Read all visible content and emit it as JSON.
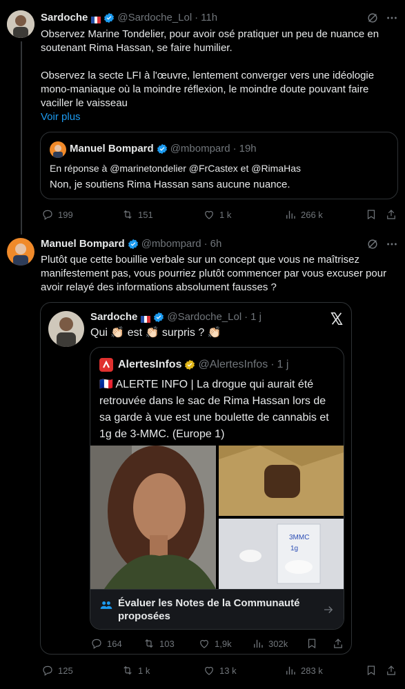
{
  "tweet1": {
    "name": "Sardoche",
    "handle": "@Sardoche_Lol",
    "sep": "·",
    "time": "11h",
    "para1": "Observez Marine Tondelier, pour avoir osé pratiquer un peu de nuance en soutenant Rima Hassan, se faire humilier.",
    "para2": "Observez la secte LFI à l'œuvre, lentement converger vers une idéologie mono-maniaque où la moindre réflexion, le moindre doute pouvant faire vaciller le vaisseau",
    "show_more": "Voir plus",
    "quote": {
      "name": "Manuel Bompard",
      "handle": "@mbompard",
      "sep": "·",
      "time": "19h",
      "reply_prefix": "En réponse à",
      "reply_to": "@marinetondelier @FrCastex  et  @RimaHas",
      "text": "Non, je soutiens Rima Hassan sans aucune nuance."
    },
    "stats": {
      "replies": "199",
      "reposts": "151",
      "likes": "1 k",
      "views": "266 k"
    }
  },
  "tweet2": {
    "name": "Manuel Bompard",
    "handle": "@mbompard",
    "sep": "·",
    "time": "6h",
    "text": "Plutôt que cette bouillie verbale sur un concept que vous ne maîtrisez manifestement pas, vous pourriez plutôt commencer par vous excuser pour avoir relayé des informations absolument fausses ?",
    "embed": {
      "name": "Sardoche",
      "handle": "@Sardoche_Lol",
      "sep": "·",
      "time": "1 j",
      "text": "Qui 👏🏻 est 👏🏻 surpris ? 👏🏻",
      "quote": {
        "name": "AlertesInfos",
        "handle": "@AlertesInfos",
        "sep": "·",
        "time": "1 j",
        "text": "🇫🇷 ALERTE INFO | La drogue qui aurait été retrouvée dans le sac de Rima Hassan lors de sa garde à vue est une boulette de cannabis et 1g de 3-MMC. (Europe 1)",
        "bag_label_1": "3MMC",
        "bag_label_2": "1g"
      },
      "notes_label": "Évaluer les Notes de la Communauté proposées",
      "stats": {
        "replies": "164",
        "reposts": "103",
        "likes": "1,9k",
        "views": "302k"
      }
    },
    "stats": {
      "replies": "125",
      "reposts": "1 k",
      "likes": "13 k",
      "views": "283 k"
    }
  },
  "colors": {
    "accent": "#1d9bf0",
    "muted": "#71767b",
    "border": "#2f3336",
    "verified": "#1d9bf0",
    "gold": "#e2b719"
  }
}
